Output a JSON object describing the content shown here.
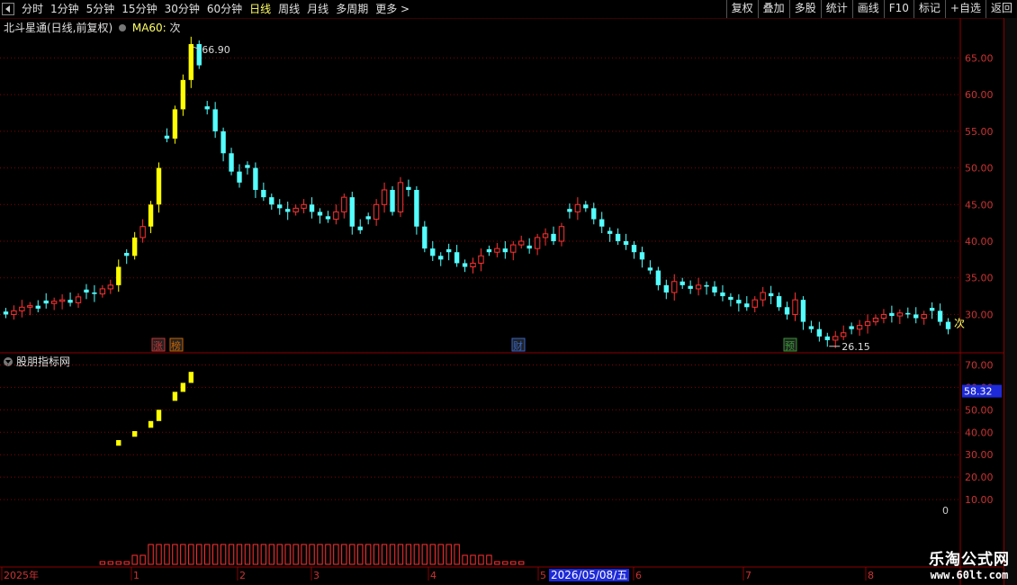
{
  "toolbar": {
    "periods": [
      {
        "label": "分时"
      },
      {
        "label": "1分钟"
      },
      {
        "label": "5分钟"
      },
      {
        "label": "15分钟"
      },
      {
        "label": "30分钟"
      },
      {
        "label": "60分钟"
      },
      {
        "label": "日线",
        "active": true
      },
      {
        "label": "周线"
      },
      {
        "label": "月线"
      },
      {
        "label": "多周期"
      },
      {
        "label": "更多 >"
      }
    ],
    "right_buttons": [
      "复权",
      "叠加",
      "多股",
      "统计",
      "画线",
      "F10",
      "标记",
      "+自选",
      "返回"
    ]
  },
  "main_panel": {
    "title": "北斗星通(日线,前复权)",
    "ma_label": "MA60:",
    "ma_value": "次",
    "high_label": "66.90",
    "low_label": "26.15",
    "last_marker": "次",
    "y_ticks": [
      "65.00",
      "60.00",
      "55.00",
      "50.00",
      "45.00",
      "40.00",
      "35.00",
      "30.00"
    ],
    "event_markers": [
      {
        "label": "涨",
        "color": "#cc3333"
      },
      {
        "label": "榜",
        "color": "#cc6600"
      },
      {
        "label": "财",
        "color": "#3366cc"
      },
      {
        "label": "预",
        "color": "#339933"
      }
    ]
  },
  "indicator_panel": {
    "title": "股朋指标网",
    "current_value": "58.32",
    "zero_label": "0",
    "y_ticks": [
      "70.00",
      "60.00",
      "50.00",
      "40.00",
      "30.00",
      "20.00",
      "10.00"
    ]
  },
  "x_axis": {
    "labels": [
      "2025年",
      "1",
      "2",
      "3",
      "4",
      "5",
      "6",
      "7",
      "8"
    ],
    "cursor_date": "2026/05/08/五"
  },
  "watermark": {
    "name": "乐淘公式网",
    "url": "www.60lt.com"
  },
  "colors": {
    "up": "#ff3232",
    "down": "#54ffff",
    "limit_up": "#ffff00",
    "grid": "#8a0000",
    "axis_text": "#cc3333"
  },
  "chart_data": {
    "type": "candlestick",
    "y_range": [
      26,
      68
    ],
    "indicator_range": [
      0,
      75
    ],
    "high": 66.9,
    "low": 26.15,
    "series_close": [
      30.0,
      30.5,
      31.0,
      31.2,
      30.8,
      31.5,
      31.8,
      32.0,
      31.6,
      32.4,
      33.0,
      32.8,
      33.5,
      34.0,
      36.5,
      38.0,
      40.5,
      42.0,
      45.0,
      50.0,
      54.0,
      58.0,
      62.0,
      66.9,
      64.0,
      58.0,
      55.0,
      52.0,
      49.5,
      48.0,
      50.0,
      47.0,
      46.0,
      45.0,
      44.5,
      44.0,
      44.5,
      45.0,
      44.0,
      43.5,
      43.0,
      44.0,
      46.0,
      42.0,
      41.5,
      43.0,
      45.0,
      47.0,
      44.0,
      48.0,
      47.0,
      42.0,
      39.0,
      38.0,
      37.5,
      38.5,
      37.0,
      36.5,
      37.0,
      38.0,
      38.5,
      39.0,
      38.5,
      39.5,
      40.0,
      39.0,
      40.5,
      41.0,
      40.0,
      42.0,
      44.0,
      45.0,
      44.5,
      43.0,
      42.0,
      41.0,
      40.0,
      39.5,
      38.5,
      37.5,
      36.0,
      34.0,
      33.0,
      34.5,
      34.0,
      33.5,
      34.0,
      33.8,
      33.0,
      32.5,
      32.0,
      31.5,
      31.0,
      32.0,
      33.0,
      32.5,
      31.0,
      30.0,
      32.0,
      29.0,
      28.0,
      27.0,
      26.5,
      27.0,
      27.5,
      28.0,
      28.5,
      29.0,
      29.5,
      30.0,
      29.8,
      30.2,
      30.0,
      29.5,
      30.0,
      30.5,
      29.0,
      28.0
    ]
  }
}
